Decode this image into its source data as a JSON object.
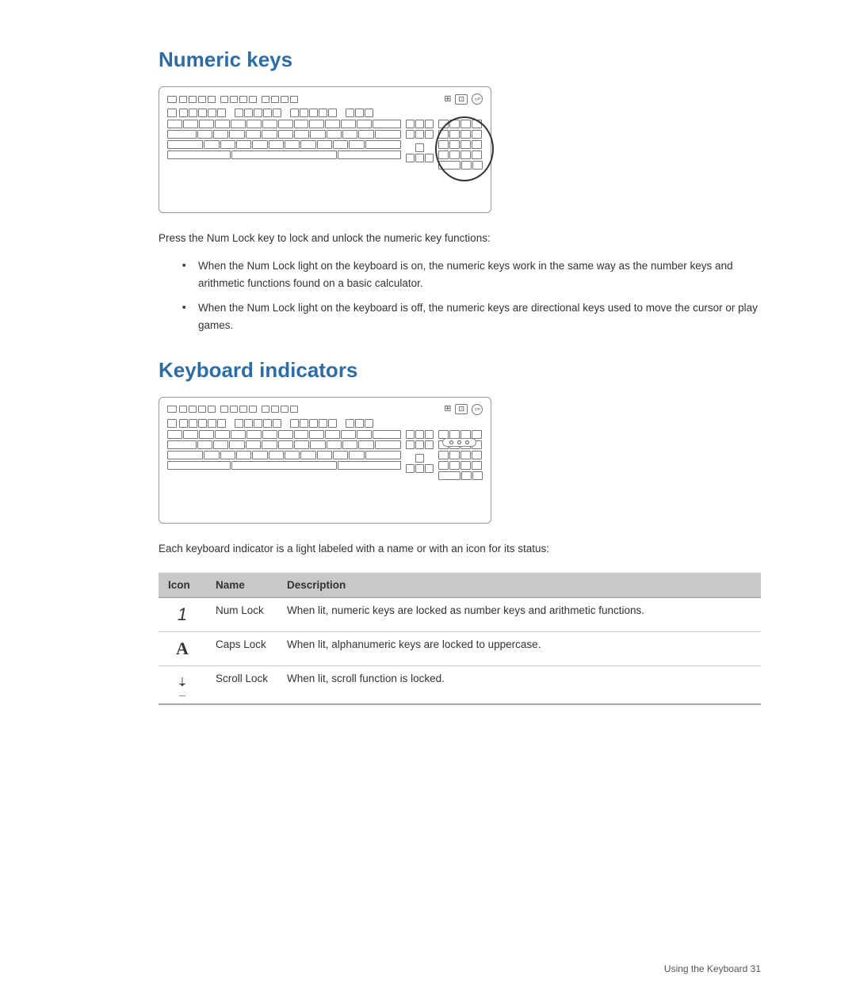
{
  "page": {
    "title": "Numeric keys",
    "title2": "Keyboard indicators",
    "footer": "Using the Keyboard    31"
  },
  "numeric_keys": {
    "intro": "Press the Num Lock key to lock and unlock the numeric key functions:",
    "bullets": [
      "When the Num Lock light on the keyboard is on, the numeric keys work in the same way as the number keys and arithmetic functions found on a basic calculator.",
      "When the Num Lock light on the keyboard is off, the numeric keys are directional keys used to move the cursor or play games."
    ]
  },
  "keyboard_indicators": {
    "intro": "Each keyboard indicator is a light labeled with a name or with an icon for its status:",
    "table": {
      "headers": [
        "Icon",
        "Name",
        "Description"
      ],
      "rows": [
        {
          "icon": "1",
          "name": "Num Lock",
          "description": "When lit, numeric keys are locked as number keys and arithmetic functions."
        },
        {
          "icon": "A",
          "name": "Caps Lock",
          "description": "When lit, alphanumeric keys are locked to uppercase."
        },
        {
          "icon": "scroll",
          "name": "Scroll Lock",
          "description": "When lit, scroll function is locked."
        }
      ]
    }
  }
}
